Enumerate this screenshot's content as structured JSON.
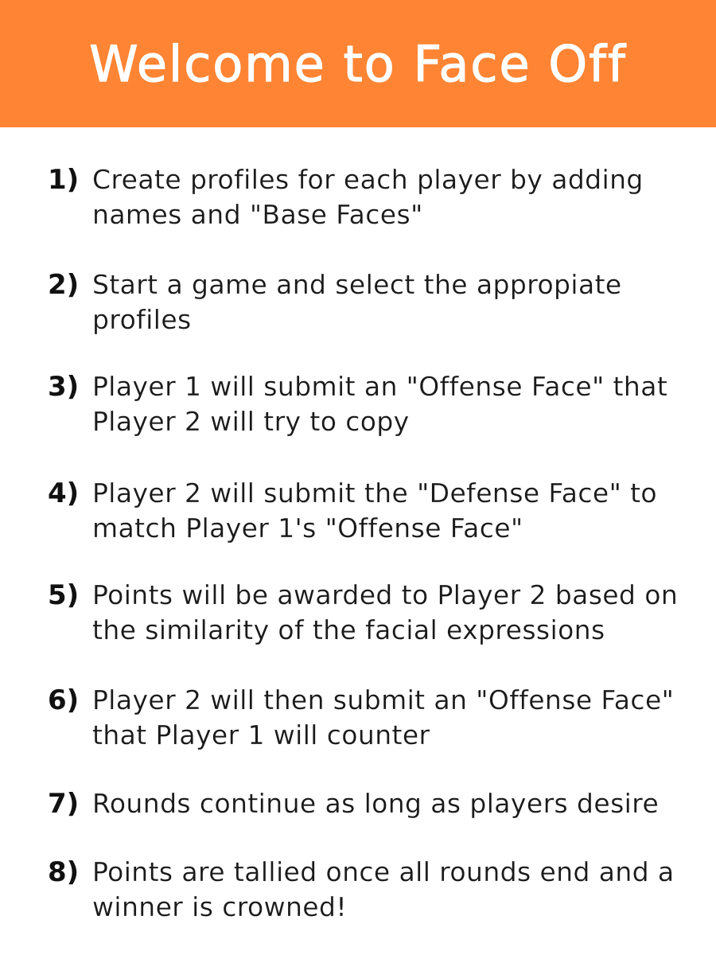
{
  "header": {
    "title": "Welcome to Face Off",
    "background_color": "#ff8433",
    "text_color": "#ffffff"
  },
  "steps": [
    {
      "number": "1)",
      "text": "Create profiles for each player by adding names and \"Base Faces\""
    },
    {
      "number": "2)",
      "text": "Start a game and select the appropiate profiles"
    },
    {
      "number": "3)",
      "text": "Player 1 will submit an \"Offense Face\" that Player 2 will try to copy"
    },
    {
      "number": "4)",
      "text": "Player 2 will submit the \"Defense Face\" to match Player 1's \"Offense Face\""
    },
    {
      "number": "5)",
      "text": "Points will be awarded to Player 2 based on the similarity of the facial expressions"
    },
    {
      "number": "6)",
      "text": "Player 2 will then submit an \"Offense Face\" that Player 1 will counter"
    },
    {
      "number": "7)",
      "text": "Rounds continue as long as players desire"
    },
    {
      "number": "8)",
      "text": "Points are tallied once all rounds end and a winner is crowned!"
    }
  ]
}
